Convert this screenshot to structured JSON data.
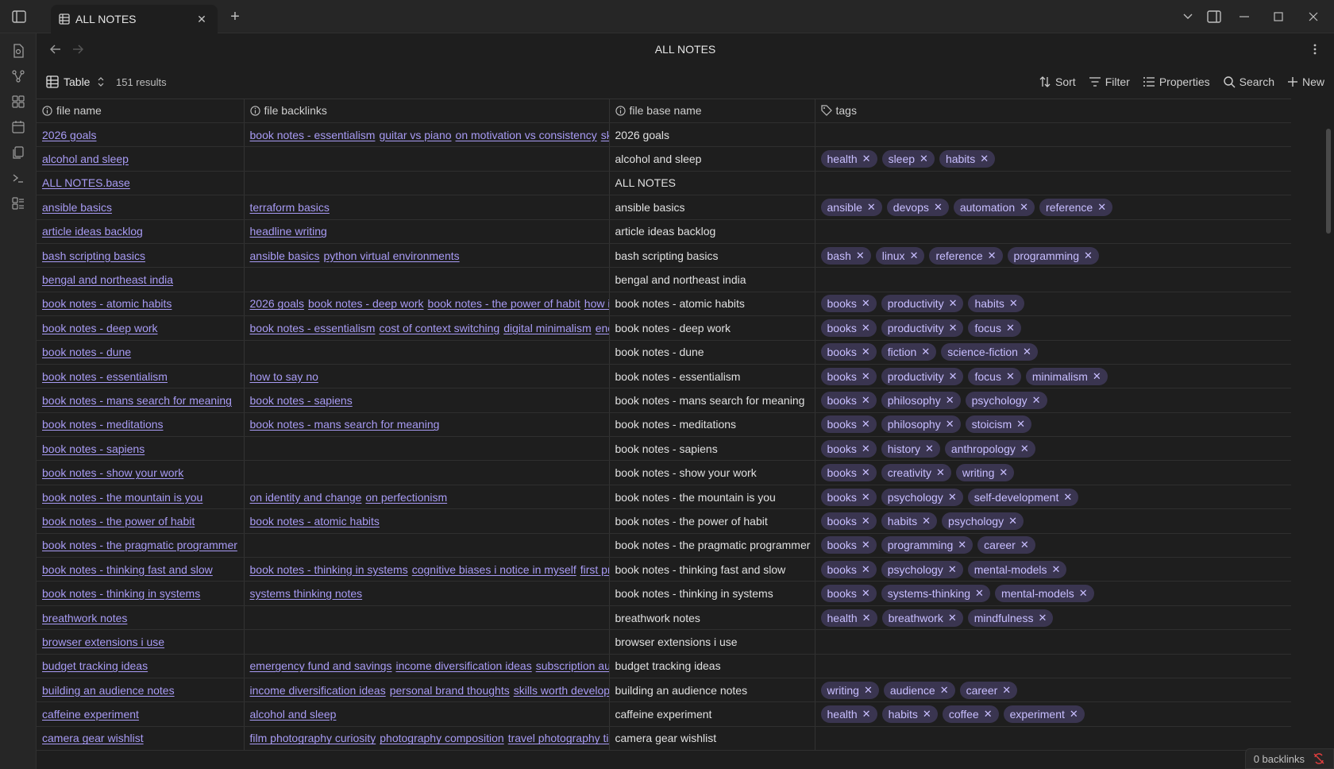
{
  "titlebar": {
    "tab_title": "ALL NOTES"
  },
  "view": {
    "title": "ALL NOTES",
    "mode_label": "Table",
    "results": "151 results",
    "actions": {
      "sort": "Sort",
      "filter": "Filter",
      "properties": "Properties",
      "search": "Search",
      "new": "New"
    }
  },
  "columns": [
    "file name",
    "file backlinks",
    "file base name",
    "tags"
  ],
  "rows": [
    {
      "name": "2026 goals",
      "backlinks": [
        "book notes - essentialism",
        "guitar vs piano",
        "on motivation vs consistency",
        "skills worth developing"
      ],
      "base": "2026 goals",
      "tags": []
    },
    {
      "name": "alcohol and sleep",
      "backlinks": [],
      "base": "alcohol and sleep",
      "tags": [
        "health",
        "sleep",
        "habits"
      ]
    },
    {
      "name": "ALL NOTES.base",
      "backlinks": [],
      "base": "ALL NOTES",
      "tags": []
    },
    {
      "name": "ansible basics",
      "backlinks": [
        "terraform basics"
      ],
      "base": "ansible basics",
      "tags": [
        "ansible",
        "devops",
        "automation",
        "reference"
      ]
    },
    {
      "name": "article ideas backlog",
      "backlinks": [
        "headline writing"
      ],
      "base": "article ideas backlog",
      "tags": []
    },
    {
      "name": "bash scripting basics",
      "backlinks": [
        "ansible basics",
        "python virtual environments"
      ],
      "base": "bash scripting basics",
      "tags": [
        "bash",
        "linux",
        "reference",
        "programming"
      ]
    },
    {
      "name": "bengal and northeast india",
      "backlinks": [],
      "base": "bengal and northeast india",
      "tags": []
    },
    {
      "name": "book notes - atomic habits",
      "backlinks": [
        "2026 goals",
        "book notes - deep work",
        "book notes - the power of habit",
        "how i track habits"
      ],
      "base": "book notes - atomic habits",
      "tags": [
        "books",
        "productivity",
        "habits"
      ]
    },
    {
      "name": "book notes - deep work",
      "backlinks": [
        "book notes - essentialism",
        "cost of context switching",
        "digital minimalism",
        "energy management"
      ],
      "base": "book notes - deep work",
      "tags": [
        "books",
        "productivity",
        "focus"
      ]
    },
    {
      "name": "book notes - dune",
      "backlinks": [],
      "base": "book notes - dune",
      "tags": [
        "books",
        "fiction",
        "science-fiction"
      ]
    },
    {
      "name": "book notes - essentialism",
      "backlinks": [
        "how to say no"
      ],
      "base": "book notes - essentialism",
      "tags": [
        "books",
        "productivity",
        "focus",
        "minimalism"
      ]
    },
    {
      "name": "book notes - mans search for meaning",
      "backlinks": [
        "book notes - sapiens"
      ],
      "base": "book notes - mans search for meaning",
      "tags": [
        "books",
        "philosophy",
        "psychology"
      ]
    },
    {
      "name": "book notes - meditations",
      "backlinks": [
        "book notes - mans search for meaning"
      ],
      "base": "book notes - meditations",
      "tags": [
        "books",
        "philosophy",
        "stoicism"
      ]
    },
    {
      "name": "book notes - sapiens",
      "backlinks": [],
      "base": "book notes - sapiens",
      "tags": [
        "books",
        "history",
        "anthropology"
      ]
    },
    {
      "name": "book notes - show your work",
      "backlinks": [],
      "base": "book notes - show your work",
      "tags": [
        "books",
        "creativity",
        "writing"
      ]
    },
    {
      "name": "book notes - the mountain is you",
      "backlinks": [
        "on identity and change",
        "on perfectionism"
      ],
      "base": "book notes - the mountain is you",
      "tags": [
        "books",
        "psychology",
        "self-development"
      ]
    },
    {
      "name": "book notes - the power of habit",
      "backlinks": [
        "book notes - atomic habits"
      ],
      "base": "book notes - the power of habit",
      "tags": [
        "books",
        "habits",
        "psychology"
      ]
    },
    {
      "name": "book notes - the pragmatic programmer",
      "backlinks": [],
      "base": "book notes - the pragmatic programmer",
      "tags": [
        "books",
        "programming",
        "career"
      ]
    },
    {
      "name": "book notes - thinking fast and slow",
      "backlinks": [
        "book notes - thinking in systems",
        "cognitive biases i notice in myself",
        "first principles thinking"
      ],
      "base": "book notes - thinking fast and slow",
      "tags": [
        "books",
        "psychology",
        "mental-models"
      ]
    },
    {
      "name": "book notes - thinking in systems",
      "backlinks": [
        "systems thinking notes"
      ],
      "base": "book notes - thinking in systems",
      "tags": [
        "books",
        "systems-thinking",
        "mental-models"
      ]
    },
    {
      "name": "breathwork notes",
      "backlinks": [],
      "base": "breathwork notes",
      "tags": [
        "health",
        "breathwork",
        "mindfulness"
      ]
    },
    {
      "name": "browser extensions i use",
      "backlinks": [],
      "base": "browser extensions i use",
      "tags": []
    },
    {
      "name": "budget tracking ideas",
      "backlinks": [
        "emergency fund and savings",
        "income diversification ideas",
        "subscription audit"
      ],
      "base": "budget tracking ideas",
      "tags": []
    },
    {
      "name": "building an audience notes",
      "backlinks": [
        "income diversification ideas",
        "personal brand thoughts",
        "skills worth developing"
      ],
      "base": "building an audience notes",
      "tags": [
        "writing",
        "audience",
        "career"
      ]
    },
    {
      "name": "caffeine experiment",
      "backlinks": [
        "alcohol and sleep"
      ],
      "base": "caffeine experiment",
      "tags": [
        "health",
        "habits",
        "coffee",
        "experiment"
      ]
    },
    {
      "name": "camera gear wishlist",
      "backlinks": [
        "film photography curiosity",
        "photography composition",
        "travel photography tips"
      ],
      "base": "camera gear wishlist",
      "tags": []
    }
  ],
  "status": {
    "backlinks": "0 backlinks"
  },
  "colors": {
    "link": "#a89bf4",
    "tag_bg": "#3a3550",
    "tag_text": "#c8beff",
    "sync_error": "#e03e3e"
  }
}
